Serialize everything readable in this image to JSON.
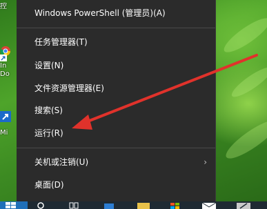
{
  "desktop": {
    "icons": [
      {
        "label": "控",
        "icon": "app-icon"
      },
      {
        "label": "In",
        "icon": "chrome-icon"
      },
      {
        "label": "Do",
        "icon": "shortcut-icon"
      },
      {
        "label": "Mi",
        "icon": "shortcut-icon"
      }
    ]
  },
  "menu": {
    "items": [
      {
        "label": "Windows PowerShell (管理员)(A)",
        "name": "menu-item-powershell-admin"
      },
      {
        "label": "任务管理器(T)",
        "name": "menu-item-task-manager"
      },
      {
        "label": "设置(N)",
        "name": "menu-item-settings"
      },
      {
        "label": "文件资源管理器(E)",
        "name": "menu-item-file-explorer"
      },
      {
        "label": "搜索(S)",
        "name": "menu-item-search"
      },
      {
        "label": "运行(R)",
        "name": "menu-item-run"
      },
      {
        "label": "关机或注销(U)",
        "name": "menu-item-shutdown-signout",
        "submenu": true
      },
      {
        "label": "桌面(D)",
        "name": "menu-item-desktop"
      }
    ],
    "submenu_arrow": "›"
  },
  "annotation": {
    "color": "#e0322b",
    "points_to": "运行(R)"
  },
  "taskbar": {
    "icons": [
      "start-icon",
      "search-icon",
      "task-view-icon",
      "store-icon",
      "file-explorer-icon",
      "office-icon",
      "mail-icon",
      "pen-icon"
    ]
  },
  "colors": {
    "menu_background": "#2b2b2b",
    "menu_text": "#ffffff",
    "separator": "#4a4a4a",
    "taskbar": "#1f2a33"
  }
}
